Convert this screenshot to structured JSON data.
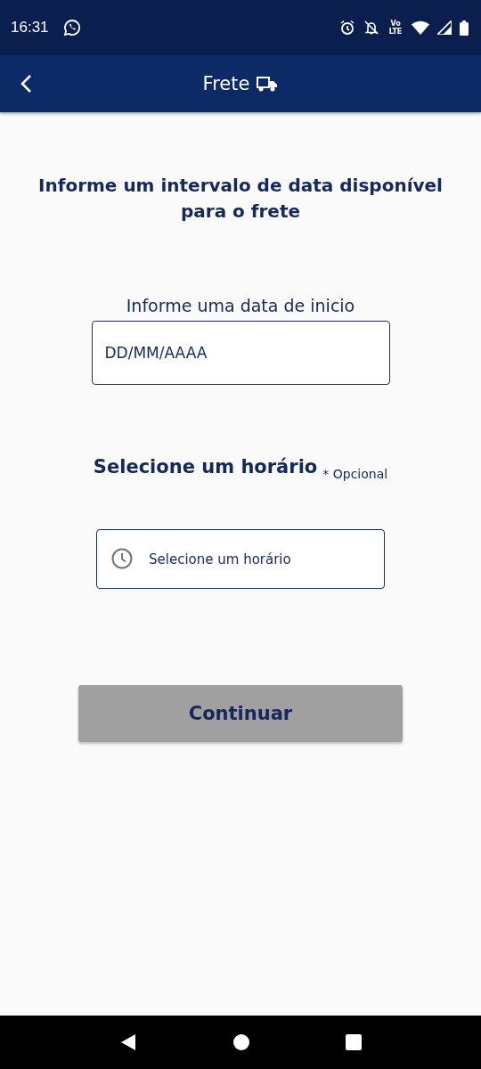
{
  "status_bar": {
    "time": "16:31",
    "network": "Vo LTE"
  },
  "app_bar": {
    "title": "Frete"
  },
  "heading": "Informe um intervalo de data disponível para o frete",
  "start_date": {
    "label": "Informe uma data de inicio",
    "placeholder": "DD/MM/AAAA"
  },
  "time": {
    "title": "Selecione um horário",
    "note": "* Opcional",
    "placeholder": "Selecione um horário"
  },
  "continue_button": {
    "label": "Continuar",
    "disabled": true
  }
}
